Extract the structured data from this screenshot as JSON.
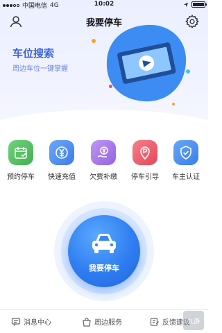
{
  "status": {
    "carrier": "中国电信",
    "network": "4G",
    "time": "10:02",
    "battery_level": 1.0
  },
  "header": {
    "title": "我要停车"
  },
  "hero": {
    "title": "车位搜索",
    "subtitle": "周边车位一键掌握"
  },
  "services": [
    {
      "label": "预约停车",
      "icon": "calendar-icon",
      "color": "#55c163"
    },
    {
      "label": "快速充值",
      "icon": "yen-coin-icon",
      "color": "#4a88ee"
    },
    {
      "label": "欠费补缴",
      "icon": "yen-hand-icon",
      "color": "#a977e6"
    },
    {
      "label": "停车引导",
      "icon": "parking-pin-icon",
      "color": "#ef5e6c"
    },
    {
      "label": "车主认证",
      "icon": "shield-check-icon",
      "color": "#3f8bf0"
    }
  ],
  "main_button": {
    "label": "我要停车"
  },
  "tabbar": [
    {
      "label": "消息中心",
      "icon": "message-icon"
    },
    {
      "label": "周边服务",
      "icon": "bag-icon"
    },
    {
      "label": "反馈建议",
      "icon": "feedback-icon"
    }
  ],
  "watermark": {
    "text": "九游"
  }
}
